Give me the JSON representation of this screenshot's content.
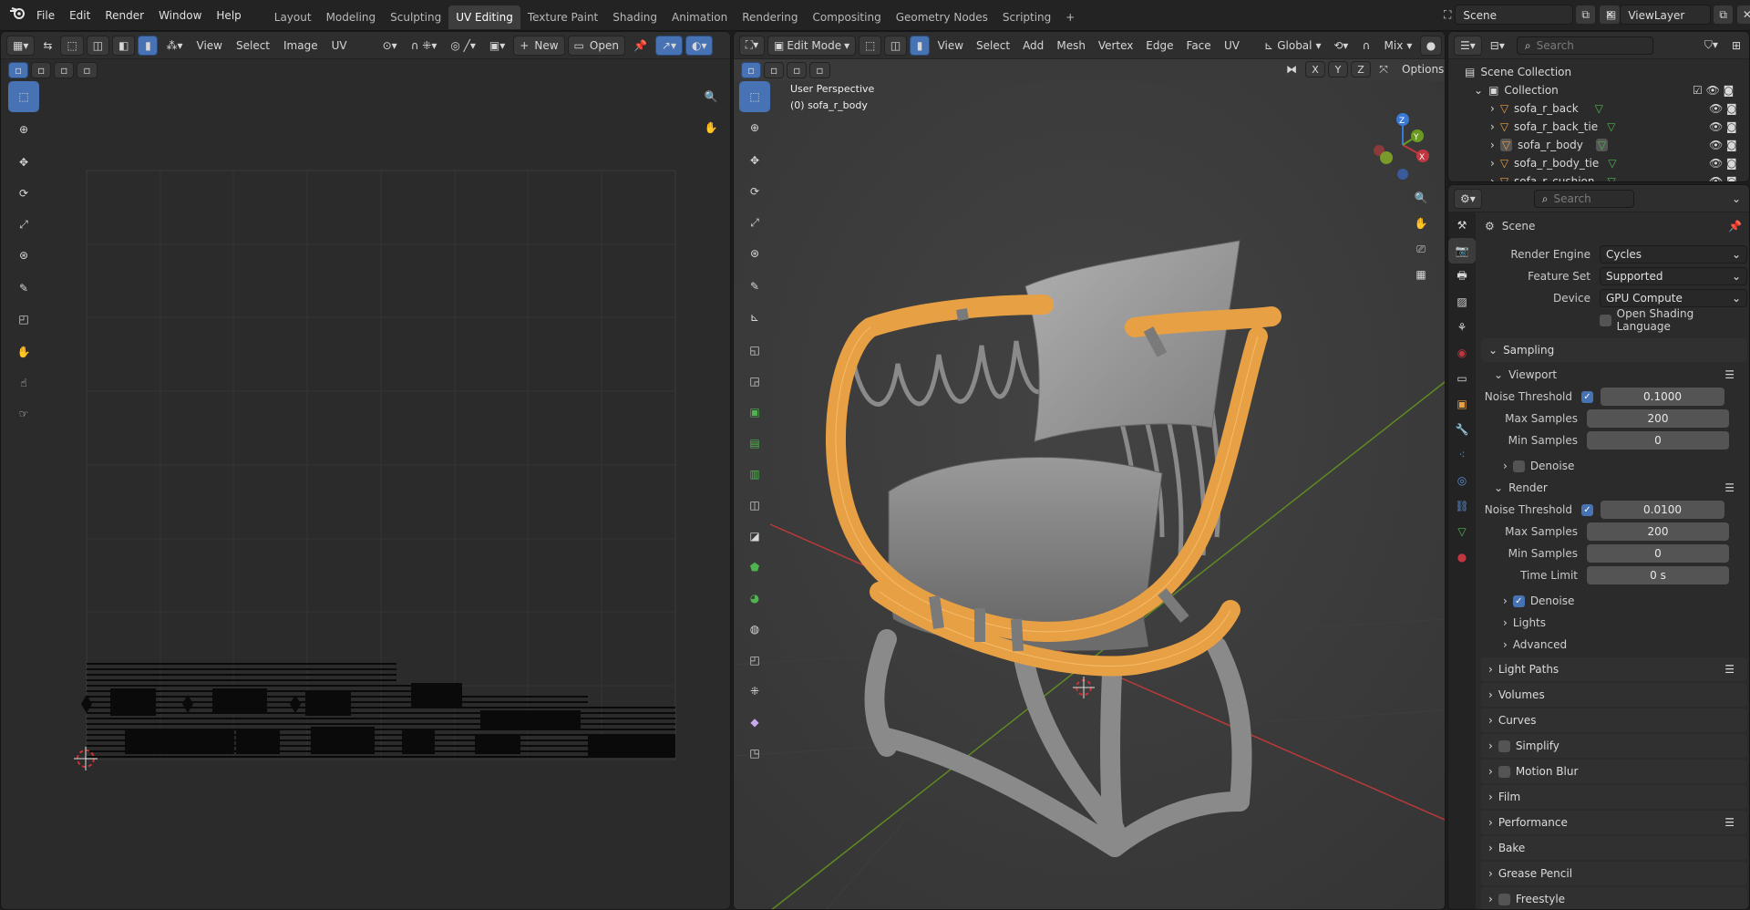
{
  "topbar": {
    "menus": [
      "File",
      "Edit",
      "Render",
      "Window",
      "Help"
    ],
    "workspaces": [
      "Layout",
      "Modeling",
      "Sculpting",
      "UV Editing",
      "Texture Paint",
      "Shading",
      "Animation",
      "Rendering",
      "Compositing",
      "Geometry Nodes",
      "Scripting"
    ],
    "active_workspace": "UV Editing",
    "add_tab": "+",
    "scene": "Scene",
    "view_layer": "ViewLayer"
  },
  "uv_editor": {
    "menus": [
      "View",
      "Select",
      "Image",
      "UV"
    ],
    "new_label": "New",
    "open_label": "Open"
  },
  "viewport": {
    "mode": "Edit Mode",
    "menus": [
      "View",
      "Select",
      "Add",
      "Mesh",
      "Vertex",
      "Edge",
      "Face",
      "UV"
    ],
    "transform_orientation": "Global",
    "proportional": "Mix",
    "axes": [
      "X",
      "Y",
      "Z"
    ],
    "options_label": "Options",
    "overlay_title": "User Perspective",
    "overlay_object": "(0) sofa_r_body",
    "gizmo": {
      "x": "X",
      "y": "Y",
      "z": "Z"
    }
  },
  "outliner": {
    "search_placeholder": "Search",
    "root": "Scene Collection",
    "collection": "Collection",
    "objects": [
      "sofa_r_back",
      "sofa_r_back_tie",
      "sofa_r_body",
      "sofa_r_body_tie",
      "sofa_r_cushion"
    ],
    "selected": "sofa_r_body"
  },
  "properties": {
    "search_placeholder": "Search",
    "context": "Scene",
    "render_engine_label": "Render Engine",
    "render_engine": "Cycles",
    "feature_set_label": "Feature Set",
    "feature_set": "Supported",
    "device_label": "Device",
    "device": "GPU Compute",
    "osl_label": "Open Shading Language",
    "sampling": "Sampling",
    "viewport": {
      "title": "Viewport",
      "noise_threshold_label": "Noise Threshold",
      "noise_threshold": "0.1000",
      "max_samples_label": "Max Samples",
      "max_samples": "200",
      "min_samples_label": "Min Samples",
      "min_samples": "0",
      "denoise_label": "Denoise"
    },
    "render": {
      "title": "Render",
      "noise_threshold_label": "Noise Threshold",
      "noise_threshold": "0.0100",
      "max_samples_label": "Max Samples",
      "max_samples": "200",
      "min_samples_label": "Min Samples",
      "min_samples": "0",
      "time_limit_label": "Time Limit",
      "time_limit": "0 s",
      "denoise_label": "Denoise"
    },
    "lights": "Lights",
    "advanced": "Advanced",
    "panels": [
      "Light Paths",
      "Volumes",
      "Curves",
      "Simplify",
      "Motion Blur",
      "Film",
      "Performance",
      "Bake",
      "Grease Pencil",
      "Freestyle"
    ]
  },
  "colors": {
    "accent": "#4772b3",
    "selection_orange": "#f0a040",
    "x_axis": "#c2373f",
    "y_axis": "#6a9a22",
    "z_axis": "#3a79d6"
  }
}
